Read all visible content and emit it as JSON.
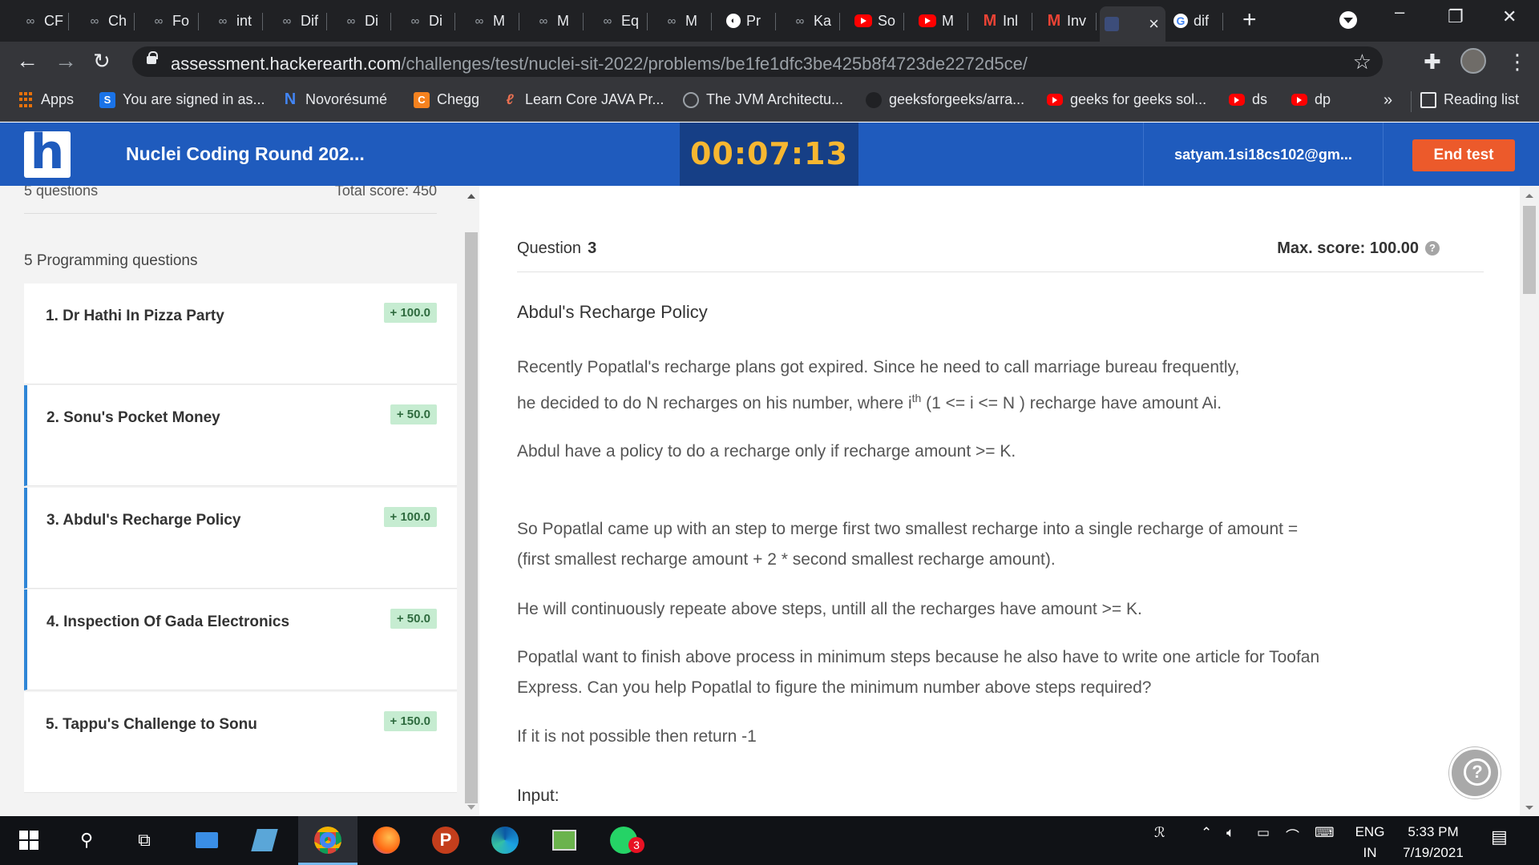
{
  "browser": {
    "tabs": [
      {
        "label": "CF",
        "icon": "hackerearth-icon"
      },
      {
        "label": "Ch",
        "icon": "hackerearth-icon"
      },
      {
        "label": "Fo",
        "icon": "hackerearth-icon"
      },
      {
        "label": "int",
        "icon": "hackerearth-icon"
      },
      {
        "label": "Dif",
        "icon": "hackerearth-icon"
      },
      {
        "label": "Di",
        "icon": "hackerearth-icon"
      },
      {
        "label": "Di",
        "icon": "hackerearth-icon"
      },
      {
        "label": "M",
        "icon": "hackerearth-icon"
      },
      {
        "label": "M",
        "icon": "hackerearth-icon"
      },
      {
        "label": "Eq",
        "icon": "hackerearth-icon"
      },
      {
        "label": "M",
        "icon": "hackerearth-icon"
      },
      {
        "label": "Pr",
        "icon": "globe-icon"
      },
      {
        "label": "Ka",
        "icon": "hackerearth-icon"
      },
      {
        "label": "So",
        "icon": "youtube-icon"
      },
      {
        "label": "M",
        "icon": "youtube-icon"
      },
      {
        "label": "Inl",
        "icon": "gmail-icon"
      },
      {
        "label": "Inv",
        "icon": "gmail-icon"
      },
      {
        "label": "",
        "icon": "page-icon",
        "active": true
      },
      {
        "label": "dif",
        "icon": "google-icon"
      }
    ],
    "url_host": "assessment.hackerearth.com",
    "url_path": "/challenges/test/nuclei-sit-2022/problems/be1fe1dfc3be425b8f4723de2272d5ce/",
    "bookmarks": [
      {
        "label": "Apps",
        "icon": "apps-grid-icon"
      },
      {
        "label": "You are signed in as...",
        "icon": "s-icon"
      },
      {
        "label": "Novorésumé",
        "icon": "novoresume-icon"
      },
      {
        "label": "Chegg",
        "icon": "chegg-icon"
      },
      {
        "label": "Learn Core JAVA Pr...",
        "icon": "java-icon"
      },
      {
        "label": "The JVM Architectu...",
        "icon": "jvm-icon"
      },
      {
        "label": "geeksforgeeks/arra...",
        "icon": "github-icon"
      },
      {
        "label": "geeks for geeks sol...",
        "icon": "youtube-icon"
      },
      {
        "label": "ds",
        "icon": "youtube-icon"
      },
      {
        "label": "dp",
        "icon": "youtube-icon"
      }
    ],
    "overflow_label": "»",
    "reading_list": "Reading list"
  },
  "header": {
    "logo_letter": "h",
    "test_title": "Nuclei Coding Round 202...",
    "timer": "00:07:13",
    "user": "satyam.1si18cs102@gm...",
    "end_test": "End test"
  },
  "sidebar": {
    "questions_count": "5 questions",
    "total_score": "Total score: 450",
    "section_title": "5 Programming questions",
    "questions": [
      {
        "label": "1.  Dr Hathi In Pizza Party",
        "score": "+ 100.0"
      },
      {
        "label": "2.  Sonu's Pocket Money",
        "score": "+ 50.0"
      },
      {
        "label": "3.  Abdul's Recharge Policy",
        "score": "+ 100.0"
      },
      {
        "label": "4.  Inspection Of Gada Electronics",
        "score": "+ 50.0"
      },
      {
        "label": "5.  Tappu's Challenge to Sonu",
        "score": "+ 150.0"
      }
    ]
  },
  "problem": {
    "question_label": "Question",
    "question_number": "3",
    "max_score": "Max. score: 100.00",
    "title": "Abdul's Recharge Policy",
    "p1_line1": "Recently Popatlal's recharge plans got expired. Since he need to call marriage bureau frequently,",
    "p1_line2_a": "he decided to do N recharges on his number, where  i",
    "p1_line2_sup": "th",
    "p1_line2_b": " (1 <= i <= N ) recharge have amount Ai.",
    "p2": "Abdul have a policy to do a recharge only if recharge amount  >= K.",
    "p3_line1": "So Popatlal came up with an step to merge first two smallest recharge into a single recharge of amount  =",
    "p3_line2": "(first smallest recharge amount  +  2  *  second smallest recharge amount).",
    "p4": "He will continuously repeate above steps, untill all the recharges have amount >= K.",
    "p5_line1": "Popatlal want to finish above process in minimum steps because he also have to write one article for Toofan",
    "p5_line2": "Express. Can you help Popatlal to figure the minimum number above steps required?",
    "p6": "If it is not possible  then return -1",
    "input_label": "Input:"
  },
  "taskbar": {
    "whatsapp_badge": "3",
    "language": "ENG",
    "region": "IN",
    "time": "5:33 PM",
    "date": "7/19/2021"
  },
  "colors": {
    "brand_blue": "#1f5bbd",
    "timer_bg": "#163f86",
    "timer_text": "#f7b731",
    "end_button": "#ec5a2b",
    "score_badge_bg": "#c6ecd1",
    "attempted_marker": "#2f86d6"
  }
}
